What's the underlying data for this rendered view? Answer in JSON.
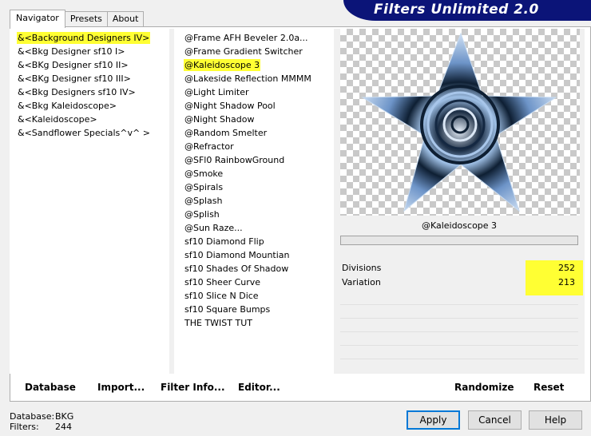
{
  "app": {
    "title": "Filters Unlimited 2.0"
  },
  "tabs": [
    {
      "label": "Navigator",
      "active": true
    },
    {
      "label": "Presets",
      "active": false
    },
    {
      "label": "About",
      "active": false
    }
  ],
  "categories": [
    {
      "label": "&<Background Designers IV>",
      "selected": true
    },
    {
      "label": "&<Bkg Designer sf10 I>"
    },
    {
      "label": "&<BKg Designer sf10 II>"
    },
    {
      "label": "&<BKg Designer sf10 III>"
    },
    {
      "label": "&<Bkg Designers sf10 IV>"
    },
    {
      "label": "&<Bkg Kaleidoscope>"
    },
    {
      "label": "&<Kaleidoscope>"
    },
    {
      "label": "&<Sandflower Specials^v^ >"
    }
  ],
  "filters": [
    {
      "label": "@Frame AFH Beveler 2.0a..."
    },
    {
      "label": "@Frame Gradient Switcher"
    },
    {
      "label": "@Kaleidoscope 3",
      "selected": true
    },
    {
      "label": "@Lakeside Reflection MMMM"
    },
    {
      "label": "@Light Limiter"
    },
    {
      "label": "@Night Shadow Pool"
    },
    {
      "label": "@Night Shadow"
    },
    {
      "label": "@Random Smelter"
    },
    {
      "label": "@Refractor"
    },
    {
      "label": "@SFl0 RainbowGround"
    },
    {
      "label": "@Smoke"
    },
    {
      "label": "@Spirals"
    },
    {
      "label": "@Splash"
    },
    {
      "label": "@Splish"
    },
    {
      "label": "@Sun Raze..."
    },
    {
      "label": "sf10 Diamond Flip"
    },
    {
      "label": "sf10 Diamond Mountian"
    },
    {
      "label": "sf10 Shades Of Shadow"
    },
    {
      "label": "sf10 Sheer Curve"
    },
    {
      "label": "sf10 Slice N Dice"
    },
    {
      "label": "sf10 Square Bumps"
    },
    {
      "label": "THE TWIST TUT"
    }
  ],
  "preview": {
    "filter_name": "@Kaleidoscope 3"
  },
  "params": [
    {
      "label": "Divisions",
      "value": "252"
    },
    {
      "label": "Variation",
      "value": "213"
    }
  ],
  "actions": {
    "database": "Database",
    "import": "Import...",
    "filter_info": "Filter Info...",
    "editor": "Editor...",
    "randomize": "Randomize",
    "reset": "Reset"
  },
  "status": {
    "database_label": "Database:",
    "database_value": "BKG",
    "filters_label": "Filters:",
    "filters_value": "244"
  },
  "dialog": {
    "apply": "Apply",
    "cancel": "Cancel",
    "help": "Help"
  },
  "colors": {
    "banner": "#0b1478",
    "highlight": "#ffff33",
    "star_dark": "#0e1f33",
    "star_light": "#8fb4e0"
  }
}
